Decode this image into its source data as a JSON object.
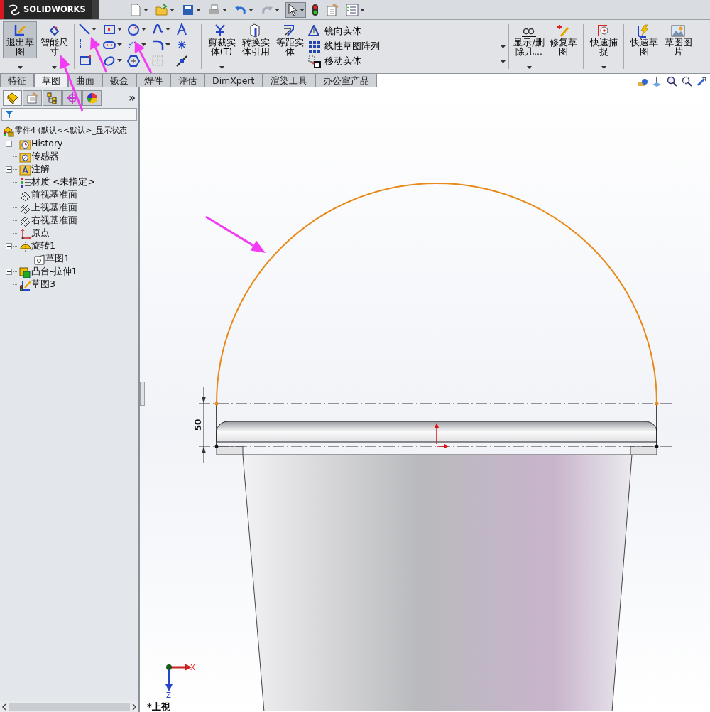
{
  "app": {
    "logo": "SOLIDWORKS"
  },
  "quick_access": {
    "select_tool": {
      "selected": true
    }
  },
  "ribbon": {
    "exit_sketch": {
      "label": "退出草图",
      "selected": true
    },
    "smart_dimension": {
      "label": "智能尺寸"
    },
    "edit_tools": [
      {
        "label": "剪裁实体(T)"
      },
      {
        "label": "转换实体引用"
      },
      {
        "label": "等距实体"
      }
    ],
    "list_tools": [
      {
        "label": "镜向实体"
      },
      {
        "label": "线性草图阵列"
      },
      {
        "label": "移动实体"
      }
    ],
    "display_tools": [
      {
        "label": "显示/删除几..."
      },
      {
        "label": "修复草图"
      }
    ],
    "snap_tools": [
      {
        "label": "快速捕捉"
      }
    ],
    "extra_tools": [
      {
        "label": "快速草图"
      },
      {
        "label": "草图图片"
      }
    ]
  },
  "tabs": [
    {
      "label": "特征",
      "selected": false
    },
    {
      "label": "草图",
      "selected": true
    },
    {
      "label": "曲面",
      "selected": false
    },
    {
      "label": "钣金",
      "selected": false
    },
    {
      "label": "焊件",
      "selected": false
    },
    {
      "label": "评估",
      "selected": false
    },
    {
      "label": "DimXpert",
      "selected": false
    },
    {
      "label": "渲染工具",
      "selected": false
    },
    {
      "label": "办公室产品",
      "selected": false
    }
  ],
  "panel": {
    "tabs": [
      {
        "selected": true
      },
      {
        "selected": false
      },
      {
        "selected": false
      },
      {
        "selected": false
      },
      {
        "selected": false
      }
    ],
    "more": "»",
    "tree": {
      "label": "零件4  (默认<<默认>_显示状态",
      "children": [
        {
          "label": "History",
          "kind": "history",
          "expanded": false
        },
        {
          "label": "传感器",
          "kind": "sensor"
        },
        {
          "label": "注解",
          "kind": "annotation",
          "expanded": false
        },
        {
          "label": "材质 <未指定>",
          "kind": "material"
        },
        {
          "label": "前视基准面",
          "kind": "plane"
        },
        {
          "label": "上视基准面",
          "kind": "plane"
        },
        {
          "label": "右视基准面",
          "kind": "plane"
        },
        {
          "label": "原点",
          "kind": "origin"
        },
        {
          "label": "旋转1",
          "kind": "revolve",
          "expanded": true,
          "children": [
            {
              "label": "草图1",
              "kind": "sketch"
            }
          ]
        },
        {
          "label": "凸台-拉伸1",
          "kind": "extrude",
          "expanded": false
        },
        {
          "label": "草图3",
          "kind": "active-sketch"
        }
      ]
    }
  },
  "graphics": {
    "dimension": "50",
    "view_label": "*上視",
    "triad": {
      "x": "X",
      "z": "Z"
    }
  }
}
